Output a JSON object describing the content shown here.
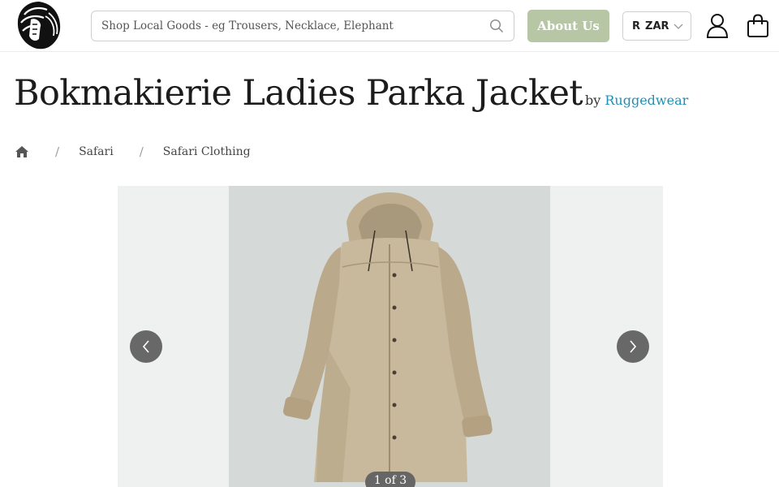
{
  "header": {
    "logo_icon": "lion-head-logo",
    "search": {
      "placeholder": "Shop Local Goods - eg Trousers, Necklace, Elephant",
      "value": "",
      "icon": "search-icon"
    },
    "about_label": "About Us",
    "currency": {
      "symbol": "R",
      "code": "ZAR"
    },
    "account_icon": "user-icon",
    "cart_icon": "shopping-bag-icon"
  },
  "product": {
    "title": "Bokmakierie Ladies Parka Jacket",
    "by": "by",
    "brand": "Ruggedwear"
  },
  "breadcrumb": {
    "home_icon": "home-icon",
    "separator": "/",
    "items": [
      "Safari",
      "Safari Clothing"
    ]
  },
  "gallery": {
    "counter": "1 of 3",
    "prev_icon": "chevron-left-icon",
    "next_icon": "chevron-right-icon"
  },
  "colors": {
    "accent_button": "#b7c6a4",
    "brand_link": "#1d8fb7",
    "jacket": "#c8b89c"
  }
}
